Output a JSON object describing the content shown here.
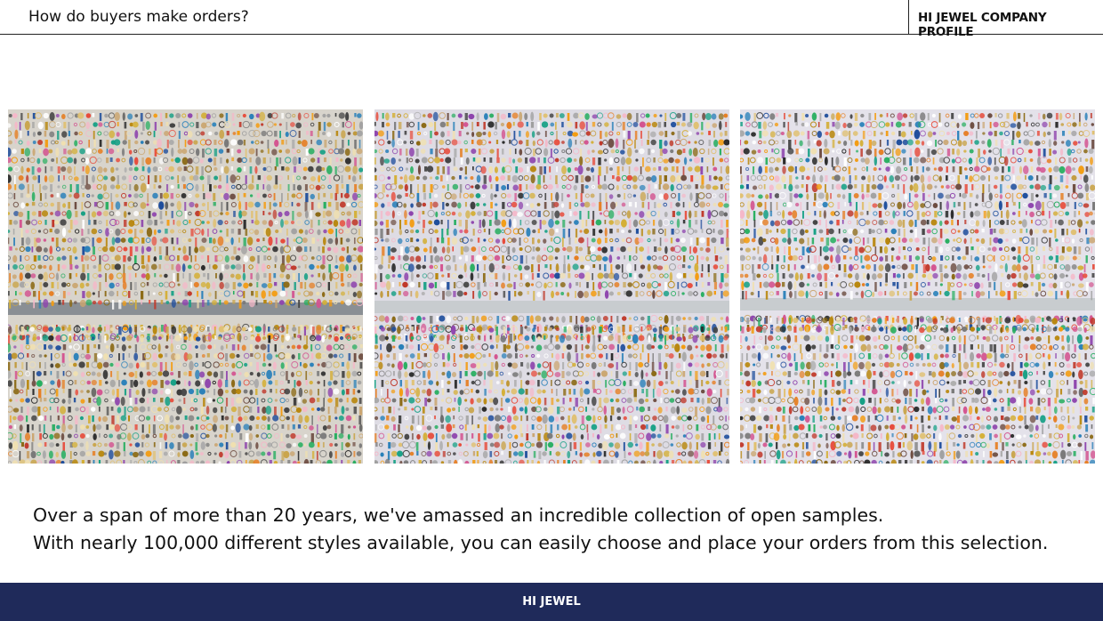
{
  "header": {
    "title": "How do buyers make orders?",
    "company": "HI JEWEL COMPANY PROFILE"
  },
  "photos": [
    {
      "subject": "earring-display-wall"
    },
    {
      "subject": "earring-display-wall"
    },
    {
      "subject": "earring-display-wall"
    }
  ],
  "caption": {
    "line1": "Over a span of more than 20 years, we've amassed an incredible collection of open samples.",
    "line2": "With nearly 100,000 different styles available, you can easily choose and place your orders from this selection."
  },
  "footer": {
    "label": "HI JEWEL"
  },
  "colors": {
    "footer_bg": "#1f2a5a",
    "board_bg": "#dcd8d0"
  }
}
